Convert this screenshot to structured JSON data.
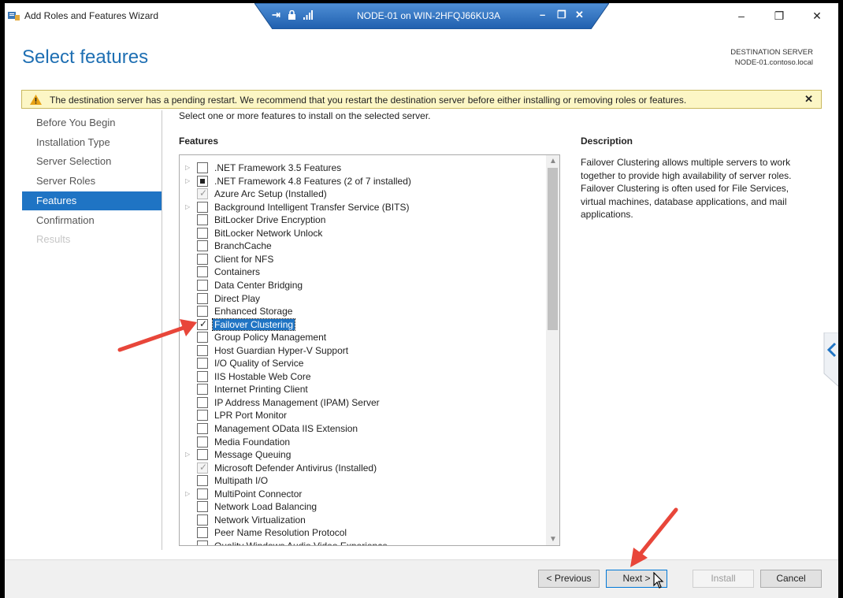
{
  "window": {
    "title": "Add Roles and Features Wizard",
    "minimize": "–",
    "maximize": "❐",
    "close": "✕"
  },
  "remote_bar": {
    "title": "NODE-01 on WIN-2HFQJ66KU3A",
    "pin": "⇥",
    "lock": "🔒",
    "signal": ".ıl",
    "minimize": "–",
    "restore": "❐",
    "close": "✕"
  },
  "page": {
    "title": "Select features",
    "dest_label": "DESTINATION SERVER",
    "dest_server": "NODE-01.contoso.local"
  },
  "warning": {
    "text": "The destination server has a pending restart. We recommend that you restart the destination server before either installing or removing roles or features.",
    "close": "✕"
  },
  "nav": {
    "items": [
      {
        "label": "Before You Begin",
        "state": "normal"
      },
      {
        "label": "Installation Type",
        "state": "normal"
      },
      {
        "label": "Server Selection",
        "state": "normal"
      },
      {
        "label": "Server Roles",
        "state": "normal"
      },
      {
        "label": "Features",
        "state": "active"
      },
      {
        "label": "Confirmation",
        "state": "normal"
      },
      {
        "label": "Results",
        "state": "disabled"
      }
    ]
  },
  "main": {
    "instruction": "Select one or more features to install on the selected server.",
    "features_heading": "Features",
    "description_heading": "Description",
    "description": "Failover Clustering allows multiple servers to work together to provide high availability of server roles. Failover Clustering is often used for File Services, virtual machines, database applications, and mail applications."
  },
  "features": [
    {
      "label": ".NET Framework 3.5 Features",
      "expandable": true,
      "state": "unchecked"
    },
    {
      "label": ".NET Framework 4.8 Features (2 of 7 installed)",
      "expandable": true,
      "state": "partial"
    },
    {
      "label": "Azure Arc Setup (Installed)",
      "expandable": false,
      "state": "installed"
    },
    {
      "label": "Background Intelligent Transfer Service (BITS)",
      "expandable": true,
      "state": "unchecked"
    },
    {
      "label": "BitLocker Drive Encryption",
      "expandable": false,
      "state": "unchecked"
    },
    {
      "label": "BitLocker Network Unlock",
      "expandable": false,
      "state": "unchecked"
    },
    {
      "label": "BranchCache",
      "expandable": false,
      "state": "unchecked"
    },
    {
      "label": "Client for NFS",
      "expandable": false,
      "state": "unchecked"
    },
    {
      "label": "Containers",
      "expandable": false,
      "state": "unchecked"
    },
    {
      "label": "Data Center Bridging",
      "expandable": false,
      "state": "unchecked"
    },
    {
      "label": "Direct Play",
      "expandable": false,
      "state": "unchecked"
    },
    {
      "label": "Enhanced Storage",
      "expandable": false,
      "state": "unchecked"
    },
    {
      "label": "Failover Clustering",
      "expandable": false,
      "state": "checked",
      "selected": true
    },
    {
      "label": "Group Policy Management",
      "expandable": false,
      "state": "unchecked"
    },
    {
      "label": "Host Guardian Hyper-V Support",
      "expandable": false,
      "state": "unchecked"
    },
    {
      "label": "I/O Quality of Service",
      "expandable": false,
      "state": "unchecked"
    },
    {
      "label": "IIS Hostable Web Core",
      "expandable": false,
      "state": "unchecked"
    },
    {
      "label": "Internet Printing Client",
      "expandable": false,
      "state": "unchecked"
    },
    {
      "label": "IP Address Management (IPAM) Server",
      "expandable": false,
      "state": "unchecked"
    },
    {
      "label": "LPR Port Monitor",
      "expandable": false,
      "state": "unchecked"
    },
    {
      "label": "Management OData IIS Extension",
      "expandable": false,
      "state": "unchecked"
    },
    {
      "label": "Media Foundation",
      "expandable": false,
      "state": "unchecked"
    },
    {
      "label": "Message Queuing",
      "expandable": true,
      "state": "unchecked"
    },
    {
      "label": "Microsoft Defender Antivirus (Installed)",
      "expandable": false,
      "state": "installed"
    },
    {
      "label": "Multipath I/O",
      "expandable": false,
      "state": "unchecked"
    },
    {
      "label": "MultiPoint Connector",
      "expandable": true,
      "state": "unchecked"
    },
    {
      "label": "Network Load Balancing",
      "expandable": false,
      "state": "unchecked"
    },
    {
      "label": "Network Virtualization",
      "expandable": false,
      "state": "unchecked"
    },
    {
      "label": "Peer Name Resolution Protocol",
      "expandable": false,
      "state": "unchecked"
    },
    {
      "label": "Quality Windows Audio Video Experience",
      "expandable": false,
      "state": "unchecked"
    }
  ],
  "buttons": {
    "previous": "< Previous",
    "next": "Next >",
    "install": "Install",
    "cancel": "Cancel"
  },
  "colors": {
    "accent": "#1f74c4",
    "title_blue": "#1e6fb3",
    "warning_bg": "#fcf6c5",
    "annotation_arrow": "#e8463a"
  }
}
